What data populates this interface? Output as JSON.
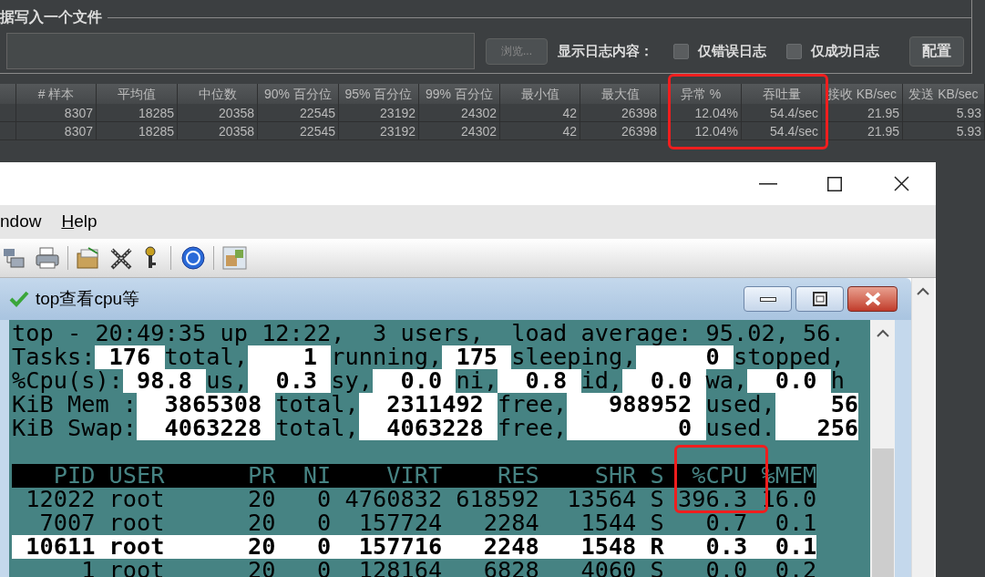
{
  "file_panel": {
    "title": "据写入一个文件",
    "browse_button": {
      "label": "浏览...",
      "disabled": true
    },
    "log_label": "显示日志内容：",
    "checkboxes": [
      {
        "label": "仅错误日志",
        "checked": false
      },
      {
        "label": "仅成功日志",
        "checked": false
      }
    ],
    "config_button": "配置"
  },
  "table": {
    "columns": [
      "# 样本",
      "平均值",
      "中位数",
      "90% 百分位",
      "95% 百分位",
      "99% 百分位",
      "最小值",
      "最大值",
      "异常 %",
      "吞吐量",
      "接收 KB/sec",
      "发送 KB/sec"
    ],
    "rows": [
      [
        "8307",
        "18285",
        "20358",
        "22545",
        "23192",
        "24302",
        "42",
        "26398",
        "12.04%",
        "54.4/sec",
        "21.95",
        "5.93"
      ],
      [
        "8307",
        "18285",
        "20358",
        "22545",
        "23192",
        "24302",
        "42",
        "26398",
        "12.04%",
        "54.4/sec",
        "21.95",
        "5.93"
      ]
    ]
  },
  "window": {
    "menu": [
      {
        "label": "ndow",
        "underline_first": false
      },
      {
        "label": "Help",
        "underline_first": true
      }
    ]
  },
  "terminal_window": {
    "title": "top查看cpu等",
    "lines": [
      {
        "kind": "text",
        "segments": [
          {
            "text": "top - 20:49:35 up 12:22,  3 users,  load average: 95.02, 56.",
            "highlight": false
          }
        ]
      },
      {
        "kind": "text",
        "segments": [
          {
            "text": "Tasks:",
            "highlight": false
          },
          {
            "text": " 176 ",
            "highlight": true
          },
          {
            "text": "total,",
            "highlight": false
          },
          {
            "text": "    1 ",
            "highlight": true
          },
          {
            "text": "running,",
            "highlight": false
          },
          {
            "text": " 175 ",
            "highlight": true
          },
          {
            "text": "sleeping,",
            "highlight": false
          },
          {
            "text": "     0 ",
            "highlight": true
          },
          {
            "text": "stopped,",
            "highlight": false
          }
        ]
      },
      {
        "kind": "text",
        "segments": [
          {
            "text": "%Cpu(s):",
            "highlight": false
          },
          {
            "text": " 98.8 ",
            "highlight": true
          },
          {
            "text": "us,",
            "highlight": false
          },
          {
            "text": "  0.3 ",
            "highlight": true
          },
          {
            "text": "sy,",
            "highlight": false
          },
          {
            "text": "  0.0 ",
            "highlight": true
          },
          {
            "text": "ni,",
            "highlight": false
          },
          {
            "text": "  0.8 ",
            "highlight": true
          },
          {
            "text": "id,",
            "highlight": false
          },
          {
            "text": "  0.0 ",
            "highlight": true
          },
          {
            "text": "wa,",
            "highlight": false
          },
          {
            "text": "  0.0 ",
            "highlight": true
          },
          {
            "text": "h",
            "highlight": false
          }
        ]
      },
      {
        "kind": "text",
        "segments": [
          {
            "text": "KiB Mem :",
            "highlight": false
          },
          {
            "text": "  3865308 ",
            "highlight": true
          },
          {
            "text": "total,",
            "highlight": false
          },
          {
            "text": "  2311492 ",
            "highlight": true
          },
          {
            "text": "free,",
            "highlight": false
          },
          {
            "text": "   988952 ",
            "highlight": true
          },
          {
            "text": "used,",
            "highlight": false
          },
          {
            "text": "    56",
            "highlight": true
          }
        ]
      },
      {
        "kind": "text",
        "segments": [
          {
            "text": "KiB Swap:",
            "highlight": false
          },
          {
            "text": "  4063228 ",
            "highlight": true
          },
          {
            "text": "total,",
            "highlight": false
          },
          {
            "text": "  4063228 ",
            "highlight": true
          },
          {
            "text": "free,",
            "highlight": false
          },
          {
            "text": "        0 ",
            "highlight": true
          },
          {
            "text": "used.",
            "highlight": false
          },
          {
            "text": "   256",
            "highlight": true
          }
        ]
      },
      {
        "kind": "blank"
      },
      {
        "kind": "header",
        "text": "   PID USER      PR  NI    VIRT    RES    SHR S  %CPU %MEM"
      },
      {
        "kind": "row",
        "text": " 12022 root      20   0 4760832 618592  13564 S 396.3 16.0",
        "selected": false
      },
      {
        "kind": "row",
        "text": "  7007 root      20   0  157724   2284   1544 S   0.7  0.1",
        "selected": false
      },
      {
        "kind": "row",
        "text": " 10611 root      20   0  157716   2248   1548 R   0.3  0.1",
        "selected": true
      },
      {
        "kind": "row",
        "text": "     1 root      20   0  128164   6828   4060 S   0.0  0.2",
        "selected": false
      }
    ]
  }
}
